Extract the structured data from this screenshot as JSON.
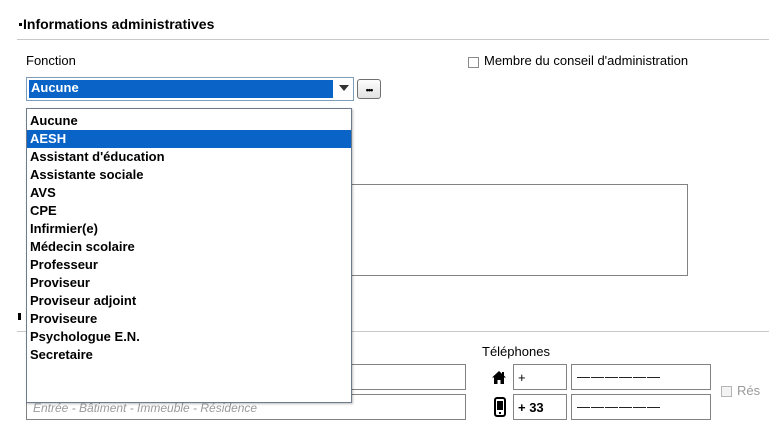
{
  "admin_section": {
    "title": "Informations administratives",
    "fonction_label": "Fonction",
    "fonction_value": "Aucune",
    "more_button_label": "•••",
    "board_member_label": "Membre du conseil d'administration"
  },
  "dropdown": {
    "options": [
      "Aucune",
      "AESH",
      "Assistant d'éducation",
      "Assistante sociale",
      "AVS",
      "CPE",
      "Infirmier(e)",
      "Médecin scolaire",
      "Professeur",
      "Proviseur",
      "Proviseur adjoint",
      "Proviseure",
      "Psychologue E.N.",
      "Secretaire"
    ],
    "highlighted": "AESH"
  },
  "contact_section": {
    "telephones_label": "Téléphones",
    "home_phone_prefix": "+",
    "home_phone_number": "——————",
    "mobile_phone_prefix": "+ 33",
    "mobile_phone_number": "——————",
    "address_placeholder": "Entrée - Bâtiment - Immeuble - Résidence",
    "res_label_partial": "Rés"
  },
  "icons": {
    "home": "home-icon",
    "mobile": "mobile-phone-icon",
    "ellipsis": "ellipsis-icon",
    "dropdown_arrow": "chevron-down-icon"
  },
  "colors": {
    "selection_blue": "#0a64c8",
    "border_gray": "#828282"
  }
}
